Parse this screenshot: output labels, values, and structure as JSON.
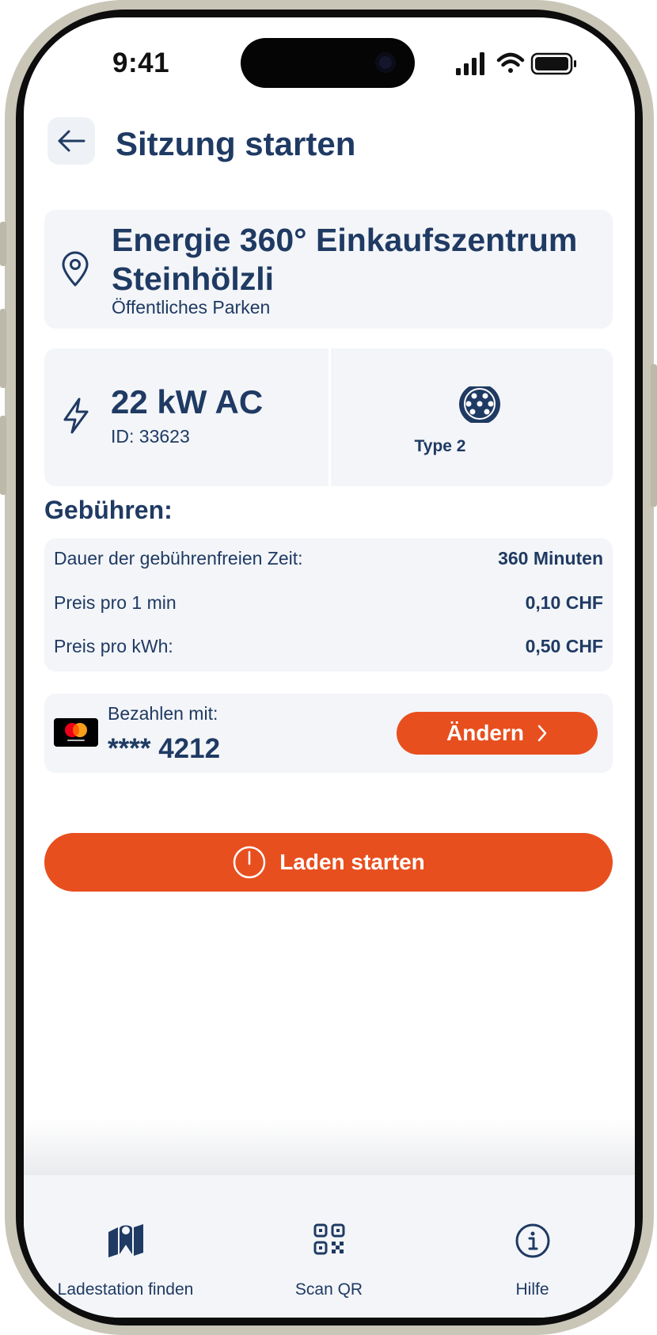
{
  "status_bar": {
    "time": "9:41"
  },
  "header": {
    "title": "Sitzung starten",
    "back_icon": "arrow-left-icon"
  },
  "location": {
    "name": "Energie 360° Einkaufszentrum Steinhölzli",
    "type": "Öffentliches Parken",
    "icon": "map-pin-icon"
  },
  "charger": {
    "power": "22 kW AC",
    "id_text": "ID: 33623",
    "connector_label": "Type 2",
    "icons": [
      "lightning-icon",
      "type2-connector-icon"
    ]
  },
  "fees": {
    "title": "Gebühren:",
    "rows": [
      {
        "label": "Dauer der gebührenfreien Zeit:",
        "value": "360 Minuten"
      },
      {
        "label": "Preis pro 1 min",
        "value": "0,10 CHF"
      },
      {
        "label": "Preis pro kWh:",
        "value": "0,50 CHF"
      }
    ]
  },
  "payment": {
    "label": "Bezahlen mit:",
    "card_number": "**** 4212",
    "change_label": "Ändern",
    "card_brand_icon": "mastercard-icon"
  },
  "start_button": {
    "label": "Laden starten",
    "icon": "power-icon"
  },
  "tabbar": {
    "items": [
      {
        "label": "Ladestation finden",
        "icon": "map-icon"
      },
      {
        "label": "Scan QR",
        "icon": "qr-code-icon"
      },
      {
        "label": "Hilfe",
        "icon": "info-icon"
      }
    ]
  },
  "colors": {
    "primary": "#1f3a63",
    "accent": "#e84f1f",
    "card_bg": "#f3f5f8"
  }
}
